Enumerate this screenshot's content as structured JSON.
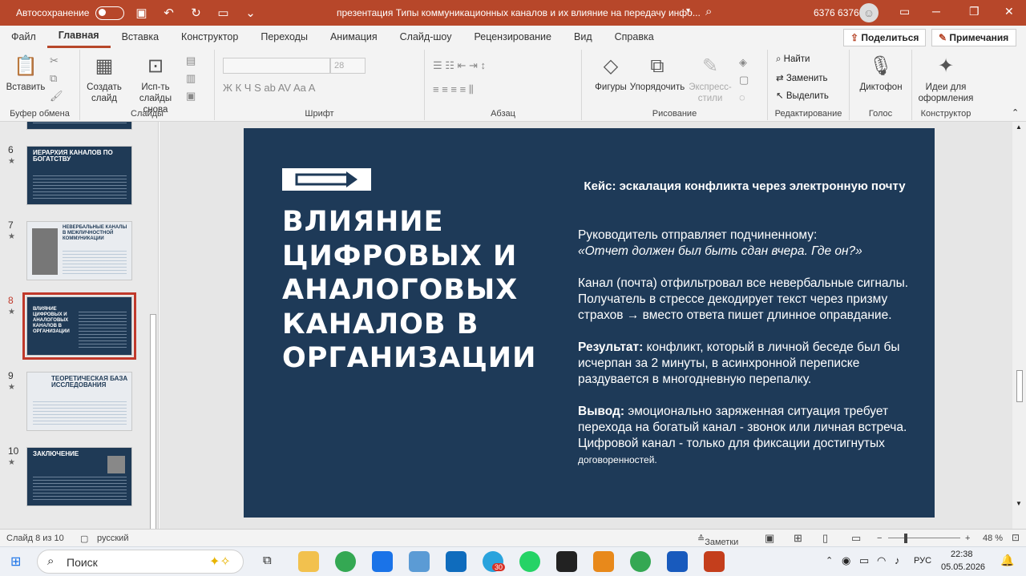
{
  "titlebar": {
    "autosave_label": "Автосохранение",
    "doc_title": "презентация Типы коммуникационных каналов и их влияние на передачу инфо...",
    "user_name": "6376 6376"
  },
  "menu": {
    "tabs": [
      "Файл",
      "Главная",
      "Вставка",
      "Конструктор",
      "Переходы",
      "Анимация",
      "Слайд-шоу",
      "Рецензирование",
      "Вид",
      "Справка"
    ],
    "share": "Поделиться",
    "notes": "Примечания"
  },
  "ribbon": {
    "paste": "Вставить",
    "clipboard": "Буфер обмена",
    "new_slide": "Создать слайд",
    "reuse": "Исп-ть слайды снова",
    "slides": "Слайды",
    "font_size": "28",
    "font": "Шрифт",
    "paragraph": "Абзац",
    "shapes": "Фигуры",
    "arrange": "Упорядочить",
    "quick_styles": "Экспресс-стили",
    "drawing": "Рисование",
    "find": "Найти",
    "replace": "Заменить",
    "select": "Выделить",
    "editing": "Редактирование",
    "dictation": "Диктофон",
    "voice": "Голос",
    "designer": "Идеи для оформления",
    "constructor": "Конструктор"
  },
  "thumbnails": [
    {
      "num": "6",
      "title": "ИЕРАРХИЯ КАНАЛОВ ПО БОГАТСТВУ",
      "style": "dark"
    },
    {
      "num": "7",
      "title": "НЕВЕРБАЛЬНЫЕ КАНАЛЫ В МЕЖЛИЧНОСТНОЙ КОММУНИКАЦИИ",
      "style": "light"
    },
    {
      "num": "8",
      "title": "ВЛИЯНИЕ ЦИФРОВЫХ И АНАЛОГОВЫХ КАНАЛОВ В ОРГАНИЗАЦИИ",
      "style": "dark"
    },
    {
      "num": "9",
      "title": "ТЕОРЕТИЧЕСКАЯ БАЗА ИССЛЕДОВАНИЯ",
      "style": "light"
    },
    {
      "num": "10",
      "title": "ЗАКЛЮЧЕНИЕ",
      "style": "dark"
    }
  ],
  "slide": {
    "title_lines": [
      "ВЛИЯНИЕ",
      "ЦИФРОВЫХ И",
      "АНАЛОГОВЫХ",
      "КАНАЛОВ В",
      "ОРГАНИЗАЦИИ"
    ],
    "case_head": "Кейс: эскалация конфликта через электронную почту",
    "p1": "Руководитель отправляет подчиненному:",
    "p1_quote": "«Отчет должен был быть сдан вчера. Где он?»",
    "p2": "Канал (почта) отфильтровал все невербальные сигналы. Получатель в стрессе декодирует текст через призму страхов → вместо ответа пишет длинное оправдание.",
    "p3_label": "Результат:",
    "p3": " конфликт, который в личной беседе был бы исчерпан за 2 минуты, в асинхронной переписке раздувается в многодневную перепалку.",
    "p4_label": "Вывод:",
    "p4": " эмоционально заряженная ситуация требует перехода на богатый канал - звонок или личная встреча. Цифровой канал - только для фиксации достигнутых",
    "p4_small": " договоренностей."
  },
  "status": {
    "slide_of": "Слайд 8 из 10",
    "language": "русский",
    "notes": "Заметки",
    "zoom": "48 %"
  },
  "taskbar": {
    "search": "Поиск",
    "lang": "РУС",
    "time": "22:38",
    "date": "05.05.2026",
    "badge": "30"
  }
}
